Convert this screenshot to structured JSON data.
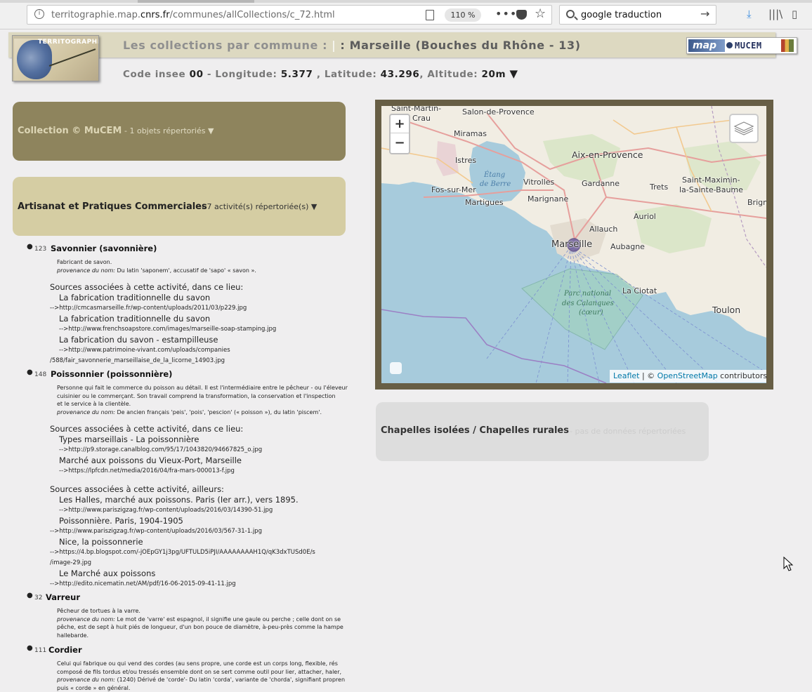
{
  "browser": {
    "url_prefix": "territographie.map.",
    "url_domain": "cnrs.fr",
    "url_path": "/communes/allCollections/c_72.html",
    "zoom": "110 %",
    "search_value": "google traduction"
  },
  "header": {
    "logo_text": "TERRITOGRAPHIE",
    "title_label": "Les collections par commune :",
    "title_sep": "|",
    "title_place": ": Marseille (Bouches du Rhône - 13)",
    "insee_label": "Code insee",
    "insee_value": "00",
    "lon_label": "- Longitude:",
    "lon_value": "5.377",
    "lat_label": ", Latitude:",
    "lat_value": "43.296",
    "alt_label": ", Altitude:",
    "alt_value": "20m",
    "toggle": "▼",
    "partner_map": "map",
    "partner_mucem": "MUCEM"
  },
  "collections": [
    {
      "title": "Collection © MuCEM",
      "subtitle": "- 1 objets répertoriés ▼"
    },
    {
      "title": "Artisanat et Pratiques Commerciales",
      "subtitle": "- 7 activité(s) répertoriée(s) ▼"
    },
    {
      "title": "Chapelles isolées / Chapelles rurales",
      "subtitle": "- pas de données répertoriées"
    }
  ],
  "activities": [
    {
      "num": "123",
      "name": "Savonnier (savonnière)",
      "desc": [
        "Fabricant de savon."
      ],
      "prov_label": "provenance du nom:",
      "prov": "Du latin 'saponem', accusatif de 'sapo' « savon ».",
      "sources_here_label": "Sources associées à cette activité, dans ce lieu:",
      "sources": [
        {
          "title": "La fabrication traditionnelle du savon",
          "link": "-->http://cmcasmarseille.fr/wp-content/uploads/2011/03/p229.jpg",
          "link2": ""
        },
        {
          "title": "La fabrication traditionnelle du savon",
          "link": "-->http://www.frenchsoapstore.com/images/marseille-soap-stamping.jpg",
          "link2": ""
        },
        {
          "title": "La fabrication du savon - estampilleuse",
          "link": "-->http://www.patrimoine-vivant.com/uploads/companies",
          "link2": "/588/fair_savonnerie_marseillaise_de_la_licorne_14903.jpg"
        }
      ]
    },
    {
      "num": "148",
      "name": "Poissonnier (poissonnière)",
      "desc": [
        "Personne qui fait le commerce du poisson au détail. Il est l'intermédiaire entre le pêcheur - ou l'éleveur",
        "cuisinier ou le commerçant. Son travail comprend la transformation, la conservation et l'inspection",
        "et le service à la clientèle."
      ],
      "prov_label": "provenance du nom:",
      "prov": "De ancien français 'peis', 'pois', 'pescion' (« poisson »), du latin 'piscem'.",
      "sources_here_label": "Sources associées à cette activité, dans ce lieu:",
      "sources": [
        {
          "title": "Types marseillais - La poissonnière",
          "link": "-->http://p9.storage.canalblog.com/95/17/1043820/94667825_o.jpg",
          "link2": ""
        },
        {
          "title": "Marché aux poissons du Vieux-Port, Marseille",
          "link": "-->https://lpfcdn.net/media/2016/04/fra-mars-000013-f.jpg",
          "link2": ""
        }
      ],
      "sources_else_label": "Sources associées à cette activité, ailleurs:",
      "sources_else": [
        {
          "title": "Les Halles, marché aux poissons. Paris (Ier arr.), vers 1895.",
          "link": "-->http://www.pariszigzag.fr/wp-content/uploads/2016/03/14390-51.jpg",
          "link_out": ""
        },
        {
          "title": "Poissonnière. Paris, 1904-1905",
          "link": "",
          "link_out": "-->http://www.pariszigzag.fr/wp-content/uploads/2016/03/567-31-1.jpg"
        },
        {
          "title": "Nice, la poissonnerie",
          "link": "",
          "link_out": "-->https://4.bp.blogspot.com/-jOEpGY1j3pg/UFTULD5iPJI/AAAAAAAAH1Q/qK3dxTUSd0E/s",
          "link_out2": "/image-29.jpg"
        },
        {
          "title": "Le Marché aux poissons",
          "link": "",
          "link_out": "-->http://edito.nicematin.net/AM/pdf/16-06-2015-09-41-11.jpg"
        }
      ]
    },
    {
      "num": "32",
      "name": "Varreur",
      "desc": [
        "Pêcheur de tortues à la varre."
      ],
      "prov_label": "provenance du nom:",
      "prov": "Le mot de 'varre' est espagnol, il signifie une gaule ou perche ; celle dont on se",
      "prov_more": [
        "pêche, est de sept à huit piés de longueur, d'un bon pouce de diamètre, à-peu-près comme la hampe",
        "hallebarde."
      ]
    },
    {
      "num": "111",
      "name": "Cordier",
      "desc": [
        "Celui qui fabrique ou qui vend des cordes (au sens propre, une corde est un corps long, flexible, rés",
        "composé de fils tordus et/ou tressés ensemble dont on se sert comme outil pour lier, attacher, haler,"
      ],
      "prov_label": "provenance du nom:",
      "prov": "(1240) Dérivé de 'corde'- Du latin 'corda', variante de 'chorda', signifiant propren",
      "prov_more": [
        "puis « corde » en général."
      ]
    }
  ],
  "map": {
    "zoom_in": "+",
    "zoom_out": "−",
    "attribution_leaflet": "Leaflet",
    "attribution_sep": " | © ",
    "attribution_osm": "OpenStreetMap",
    "attribution_end": " contributors",
    "labels": {
      "saint_martin": "Saint-Martin-",
      "crau": "Crau",
      "salon": "Salon-de-Provence",
      "miramas": "Miramas",
      "istres": "Istres",
      "etang": "Étang",
      "de_berre": "de Berre",
      "vitrolles": "Vitrolles",
      "aix": "Aix-en-Provence",
      "gardanne": "Gardanne",
      "trets": "Trets",
      "saint_maximin": "Saint-Maximin-",
      "sainte_baume": "la-Sainte-Baume",
      "brign": "Brign",
      "fos": "Fos-sur-Mer",
      "martigues": "Martigues",
      "marignane": "Marignane",
      "auriol": "Auriol",
      "allauch": "Allauch",
      "marseille": "Marseille",
      "aubagne": "Aubagne",
      "parc1": "Parc national",
      "parc2": "des Calanques",
      "parc3": "(cœur)",
      "ciotat": "La Ciotat",
      "toulon": "Toulon"
    }
  }
}
